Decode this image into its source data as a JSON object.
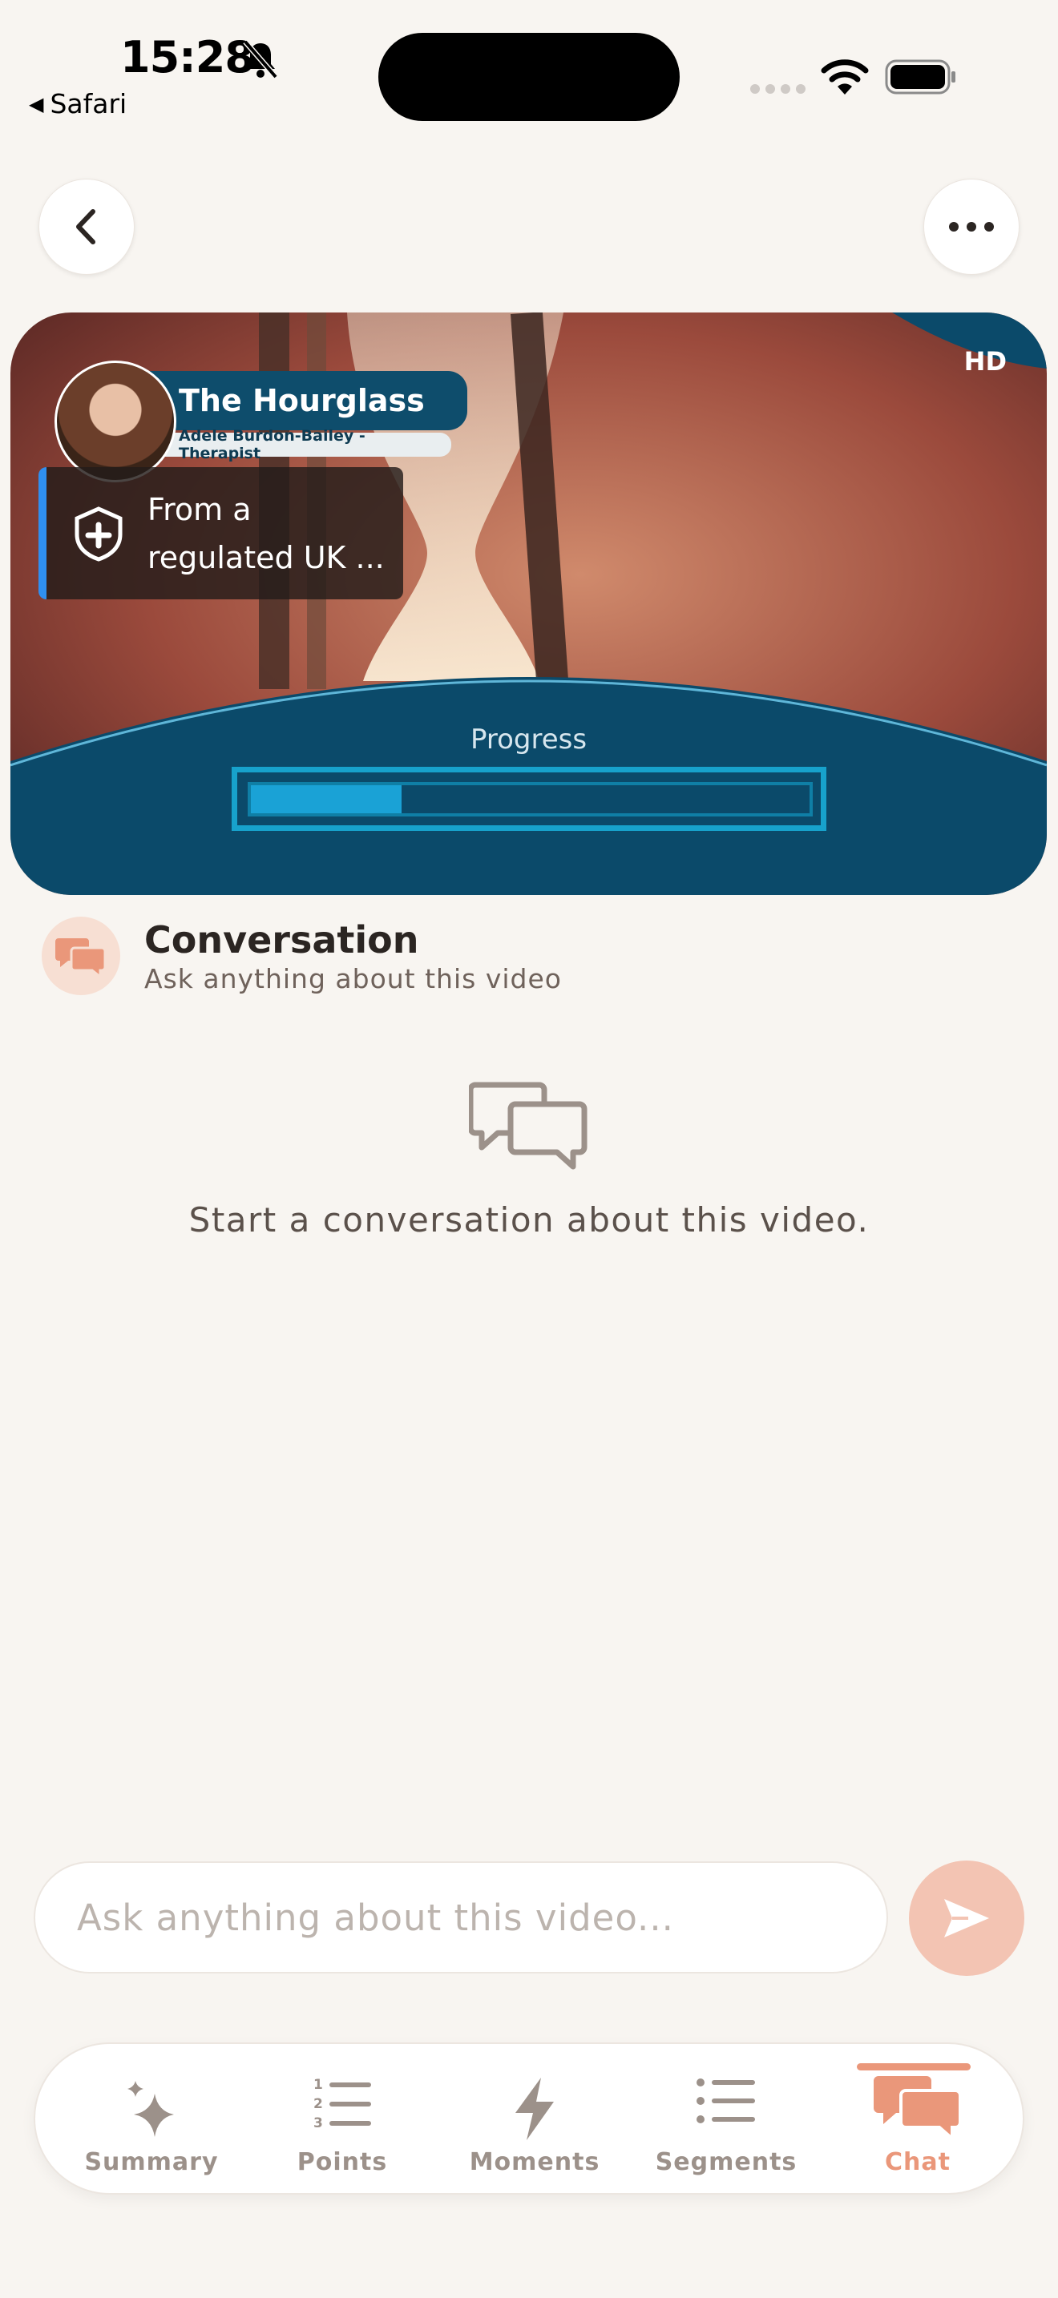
{
  "status_bar": {
    "time": "15:28",
    "back_app": "Safari"
  },
  "video": {
    "title": "The Hourglass",
    "subtitle": "Adele Burdon-Bailey - Therapist",
    "badge": "HD",
    "regulated_line1": "From a",
    "regulated_line2": "regulated UK ...",
    "progress_label": "Progress",
    "progress_fraction": 0.27
  },
  "conversation": {
    "title": "Conversation",
    "subtitle": "Ask anything about this video",
    "empty_text": "Start a conversation about this video."
  },
  "input": {
    "placeholder": "Ask anything about this video..."
  },
  "tabs": [
    {
      "label": "Summary",
      "icon": "sparkle-icon"
    },
    {
      "label": "Points",
      "icon": "numbered-list-icon"
    },
    {
      "label": "Moments",
      "icon": "lightning-icon"
    },
    {
      "label": "Segments",
      "icon": "bullet-list-icon"
    },
    {
      "label": "Chat",
      "icon": "chat-bubbles-icon",
      "active": true
    }
  ],
  "colors": {
    "accent": "#ea977a",
    "background": "#f8f5f1",
    "video_panel": "#0b4a6a",
    "progress": "#1aa2d6"
  }
}
